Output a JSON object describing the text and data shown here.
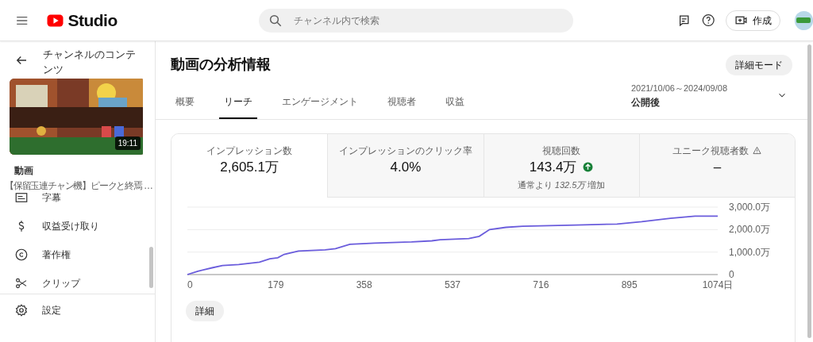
{
  "header": {
    "logo_text": "Studio",
    "search": {
      "placeholder": "チャンネル内で検索"
    },
    "create_button": "作成"
  },
  "sidebar": {
    "back_label": "チャンネルのコンテンツ",
    "video": {
      "duration": "19:11",
      "section_label": "動画",
      "title": "【保留玉連チャン機】ピークと終焉 …"
    },
    "items": [
      {
        "kind": "subtitles",
        "label": "字幕"
      },
      {
        "kind": "earn",
        "label": "収益受け取り"
      },
      {
        "kind": "copyright",
        "label": "著作権"
      },
      {
        "kind": "clip",
        "label": "クリップ"
      }
    ],
    "footer_items": [
      {
        "kind": "settings",
        "label": "設定"
      }
    ]
  },
  "main": {
    "title": "動画の分析情報",
    "advanced_button": "詳細モード",
    "tabs": [
      {
        "label": "概要",
        "selected": false
      },
      {
        "label": "リーチ",
        "selected": true
      },
      {
        "label": "エンゲージメント",
        "selected": false
      },
      {
        "label": "視聴者",
        "selected": false
      },
      {
        "label": "収益",
        "selected": false
      }
    ],
    "date_range": {
      "range": "2021/10/06～2024/09/08",
      "label": "公開後"
    },
    "metrics": [
      {
        "label": "インプレッション数",
        "value": "2,605.1万",
        "selected": true
      },
      {
        "label": "インプレッションのクリック率",
        "value": "4.0%",
        "selected": false
      },
      {
        "label": "視聴回数",
        "value": "143.4万",
        "selected": false,
        "trending_up": true,
        "note": "通常より *132.5万* 増加"
      },
      {
        "label": "ユニーク視聴者数",
        "value": "–",
        "selected": false,
        "warning": true
      }
    ],
    "chart_data": {
      "type": "line",
      "x": [
        0,
        21,
        50,
        71,
        104,
        146,
        167,
        183,
        196,
        225,
        279,
        300,
        329,
        379,
        454,
        495,
        512,
        570,
        591,
        612,
        645,
        679,
        787,
        870,
        920,
        978,
        1028,
        1074
      ],
      "series": [
        {
          "color": "#6a5cdc",
          "values": [
            0,
            150,
            300,
            400,
            450,
            550,
            700,
            750,
            900,
            1050,
            1100,
            1150,
            1350,
            1400,
            1450,
            1500,
            1550,
            1600,
            1700,
            2000,
            2100,
            2150,
            2200,
            2250,
            2350,
            2500,
            2600,
            2600
          ]
        }
      ],
      "xlim": [
        0,
        1074
      ],
      "ylim": [
        0,
        3000
      ],
      "xticks": [
        0,
        179,
        358,
        537,
        716,
        895,
        {
          "value": 1074,
          "label": "1074日"
        }
      ],
      "yticks": [
        {
          "value": 0,
          "label": "0"
        },
        {
          "value": 1000,
          "label": "1,000.0万"
        },
        {
          "value": 2000,
          "label": "2,000.0万"
        },
        {
          "value": 3000,
          "label": "3,000.0万"
        }
      ]
    },
    "details_button": "詳細"
  }
}
